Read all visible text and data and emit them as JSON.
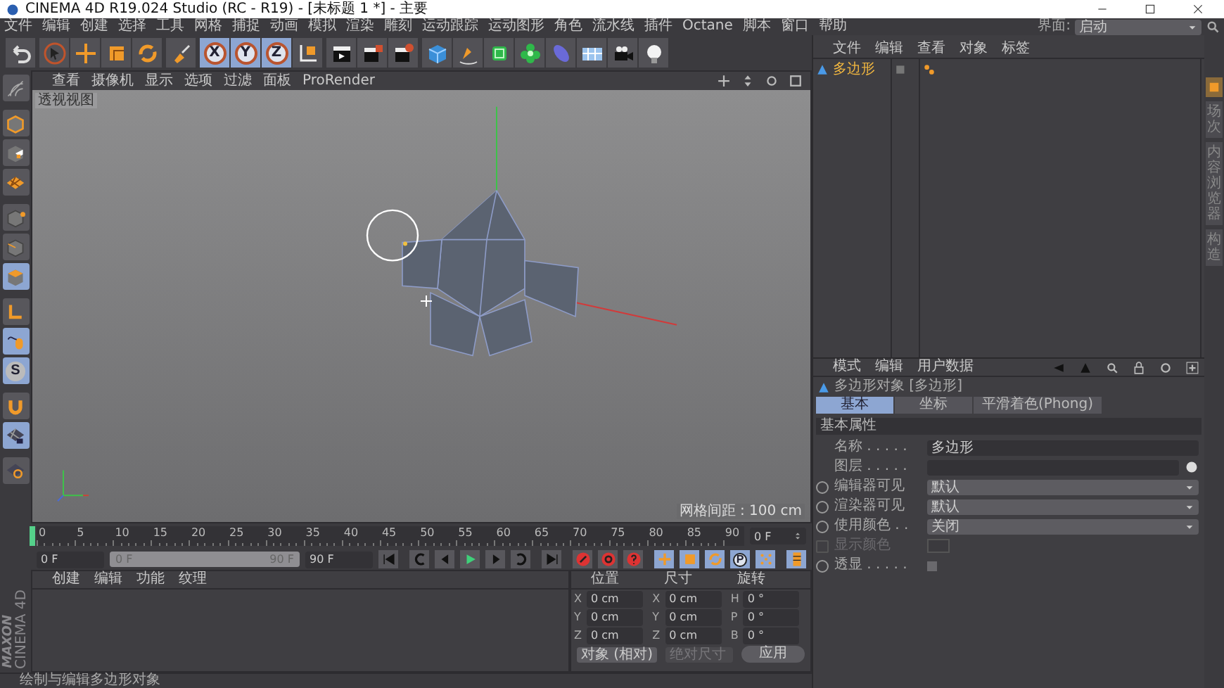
{
  "window": {
    "title": "CINEMA 4D R19.024 Studio (RC - R19) - [未标题 1 *] - 主要"
  },
  "menu": [
    "文件",
    "编辑",
    "创建",
    "选择",
    "工具",
    "网格",
    "捕捉",
    "动画",
    "模拟",
    "渲染",
    "雕刻",
    "运动跟踪",
    "运动图形",
    "角色",
    "流水线",
    "插件",
    "Octane",
    "脚本",
    "窗口",
    "帮助"
  ],
  "layout": {
    "label": "界面:",
    "value": "启动"
  },
  "toolbar": [
    {
      "tools": [
        {
          "kind": "undo",
          "selected": false
        }
      ]
    },
    {
      "tools": [
        {
          "kind": "select",
          "selected": false
        },
        {
          "kind": "move",
          "selected": false
        },
        {
          "kind": "scale",
          "selected": false
        },
        {
          "kind": "rotate",
          "selected": false
        }
      ]
    },
    {
      "tools": [
        {
          "kind": "brush",
          "selected": false
        }
      ]
    },
    {
      "tools": [
        {
          "kind": "axis",
          "label": "X",
          "selected": true
        },
        {
          "kind": "axis",
          "label": "Y",
          "selected": true
        },
        {
          "kind": "axis",
          "label": "Z",
          "selected": true
        },
        {
          "kind": "coord",
          "selected": false
        }
      ]
    },
    {
      "tools": [
        {
          "kind": "render-view",
          "selected": false
        },
        {
          "kind": "render",
          "selected": false
        },
        {
          "kind": "render-settings",
          "selected": false
        }
      ]
    },
    {
      "tools": [
        {
          "kind": "cube",
          "selected": false
        },
        {
          "kind": "pen",
          "selected": false
        },
        {
          "kind": "subdivision",
          "selected": false
        },
        {
          "kind": "cloner",
          "selected": false
        },
        {
          "kind": "deformer",
          "selected": false
        },
        {
          "kind": "floor",
          "selected": false
        },
        {
          "kind": "camera",
          "selected": false
        },
        {
          "kind": "light",
          "selected": false
        }
      ]
    }
  ],
  "tool_strip": [
    {
      "kind": "make-editable",
      "selected": false
    },
    {
      "kind": "model",
      "selected": false
    },
    {
      "kind": "texture",
      "selected": false
    },
    {
      "kind": "workplane",
      "selected": false
    },
    {
      "kind": "points",
      "selected": false
    },
    {
      "kind": "edges",
      "selected": false
    },
    {
      "kind": "polygons",
      "selected": true
    },
    {
      "kind": "axis-mode",
      "selected": false
    },
    {
      "kind": "tweak",
      "selected": true
    },
    {
      "kind": "solo",
      "label": "S",
      "selected": true
    },
    {
      "kind": "snap",
      "selected": false
    },
    {
      "kind": "lock-workplane",
      "selected": true
    },
    {
      "kind": "planar",
      "selected": false
    }
  ],
  "viewport": {
    "menu": [
      "查看",
      "摄像机",
      "显示",
      "选项",
      "过滤",
      "面板",
      "ProRender"
    ],
    "view_name": "透视视图",
    "grid_spacing": "网格间距 : 100 cm"
  },
  "timeline": {
    "ticks": [
      "0",
      "5",
      "10",
      "15",
      "20",
      "25",
      "30",
      "35",
      "40",
      "45",
      "50",
      "55",
      "60",
      "65",
      "70",
      "75",
      "80",
      "85",
      "90"
    ],
    "current_frame": "0 F"
  },
  "transport": {
    "start": "0 F",
    "range_start": "0 F",
    "range_end": "90 F",
    "end": "90 F",
    "level": 1,
    "buttons": [
      {
        "kind": "first",
        "selected": false
      },
      {
        "kind": "prev-key",
        "selected": false
      },
      {
        "kind": "prev-frame",
        "selected": false
      },
      {
        "kind": "play",
        "selected": false
      },
      {
        "kind": "next-frame",
        "selected": false
      },
      {
        "kind": "next-key",
        "selected": false
      },
      {
        "kind": "last",
        "selected": false
      },
      {
        "kind": "record",
        "selected": false
      },
      {
        "kind": "auto-key",
        "selected": false
      },
      {
        "kind": "key-help",
        "selected": false
      },
      {
        "kind": "key-move",
        "selected": true
      },
      {
        "kind": "key-scale",
        "selected": true
      },
      {
        "kind": "key-rotate",
        "selected": true
      },
      {
        "kind": "key-param",
        "label": "P",
        "selected": true
      },
      {
        "kind": "key-points",
        "selected": true
      },
      {
        "kind": "timeline",
        "selected": true
      }
    ]
  },
  "material_panel": {
    "menu": [
      "创建",
      "编辑",
      "功能",
      "纹理"
    ]
  },
  "logo": {
    "brand": "MAXON",
    "product": "CINEMA 4D"
  },
  "coordinates": {
    "headers": [
      "位置",
      "尺寸",
      "旋转"
    ],
    "rows": [
      {
        "axis": "X",
        "position": "0 cm",
        "size_axis": "X",
        "size": "0 cm",
        "rotation_axis": "H",
        "rotation": "0 °"
      },
      {
        "axis": "Y",
        "position": "0 cm",
        "size_axis": "Y",
        "size": "0 cm",
        "rotation_axis": "P",
        "rotation": "0 °"
      },
      {
        "axis": "Z",
        "position": "0 cm",
        "size_axis": "Z",
        "size": "0 cm",
        "rotation_axis": "B",
        "rotation": "0 °"
      }
    ],
    "mode": {
      "label": "对象 (相对)",
      "disabled": false
    },
    "size_mode": {
      "label": "绝对尺寸",
      "disabled": true
    },
    "apply": "应用"
  },
  "status_bar": "绘制与编辑多边形对象",
  "object_manager": {
    "menu": [
      "文件",
      "编辑",
      "查看",
      "对象",
      "标签"
    ],
    "objects": [
      {
        "name": "多边形",
        "selected": true
      }
    ]
  },
  "side_tabs": [
    {
      "kind": "icon",
      "selected": true
    },
    {
      "kind": "text",
      "label": "场次",
      "selected": false
    },
    {
      "kind": "text",
      "label": "内容浏览器",
      "selected": false
    },
    {
      "kind": "text",
      "label": "构造",
      "selected": false
    }
  ],
  "attributes": {
    "menu": [
      "模式",
      "编辑",
      "用户数据"
    ],
    "title": "多边形对象 [多边形]",
    "tabs": [
      {
        "label": "基本",
        "selected": true
      },
      {
        "label": "坐标",
        "selected": false
      },
      {
        "label": "平滑着色(Phong)",
        "selected": false
      }
    ],
    "section": "基本属性",
    "fields": [
      {
        "kind": "text",
        "label": "名称 . . . . .",
        "value": "多边形",
        "disabled": false
      },
      {
        "kind": "layer",
        "label": "图层 . . . . .",
        "disabled": false
      },
      {
        "kind": "select",
        "label": "编辑器可见",
        "value": "默认",
        "disabled": false
      },
      {
        "kind": "select",
        "label": "渲染器可见",
        "value": "默认",
        "disabled": false
      },
      {
        "kind": "select",
        "label": "使用颜色 . .",
        "value": "关闭",
        "disabled": false
      },
      {
        "kind": "color",
        "label": "显示颜色",
        "disabled": true
      },
      {
        "kind": "check",
        "label": "透显 . . . . .",
        "checked": false,
        "disabled": false
      }
    ]
  }
}
